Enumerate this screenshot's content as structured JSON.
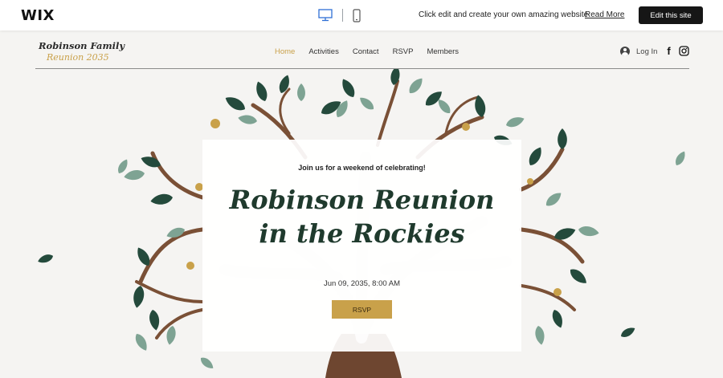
{
  "wix_bar": {
    "logo": "WIX",
    "desktop_icon": "desktop-monitor-icon",
    "mobile_icon": "mobile-phone-icon",
    "promo_text": "Click edit and create your own amazing website",
    "read_more": "Read More",
    "edit_button": "Edit this site"
  },
  "header": {
    "brand_line1": "Robinson Family",
    "brand_line2": "Reunion 2035",
    "nav": [
      "Home",
      "Activities",
      "Contact",
      "RSVP",
      "Members"
    ],
    "active_nav": "Home",
    "login_label": "Log In",
    "social": [
      "facebook-icon",
      "instagram-icon"
    ]
  },
  "hero": {
    "tagline": "Join us for a weekend of celebrating!",
    "headline_line1": "Robinson Reunion",
    "headline_line2": "in the Rockies",
    "date": "Jun 09, 2035, 8:00 AM",
    "rsvp_button": "RSVP"
  },
  "colors": {
    "accent_gold": "#c9a14a",
    "headline_green": "#1f3a2d",
    "leaf_dark": "#244a3c",
    "leaf_light": "#7ea393",
    "branch_brown": "#7a5036",
    "background": "#f5f4f2"
  }
}
